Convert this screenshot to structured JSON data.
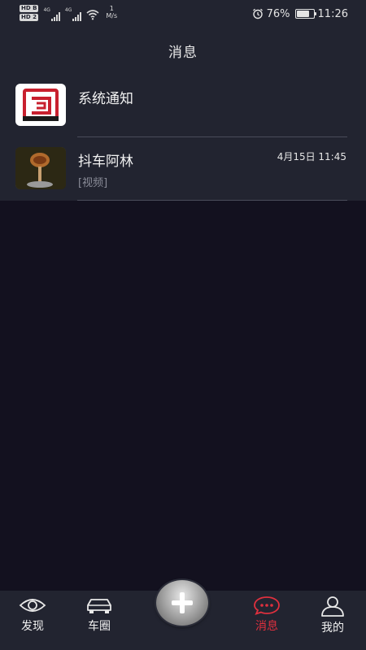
{
  "status_bar": {
    "hd1": "HD",
    "hd1_sub": "B",
    "hd2": "HD",
    "hd2_sub": "2",
    "net1": "4G",
    "net2": "4G",
    "speed_value": "1",
    "speed_unit": "M/s",
    "battery_percent": "76%",
    "battery_level": 0.76,
    "time": "11:26"
  },
  "header": {
    "title": "消息"
  },
  "messages": [
    {
      "name": "系统通知",
      "subtitle": "",
      "time": "",
      "icon": "system-notification-logo"
    },
    {
      "name": "抖车阿林",
      "subtitle": "[视频]",
      "time": "4月15日 11:45",
      "icon": "video-thumbnail"
    }
  ],
  "bottom_nav": {
    "items": [
      {
        "label": "发现",
        "icon": "eye-icon"
      },
      {
        "label": "车圈",
        "icon": "car-icon"
      },
      {
        "label": "消息",
        "icon": "chat-bubble-icon"
      },
      {
        "label": "我的",
        "icon": "user-icon"
      }
    ],
    "add_icon": "plus-icon"
  },
  "colors": {
    "background": "#13111f",
    "panel": "#222430",
    "accent": "#e0303e",
    "divider": "#4a4c5a"
  }
}
